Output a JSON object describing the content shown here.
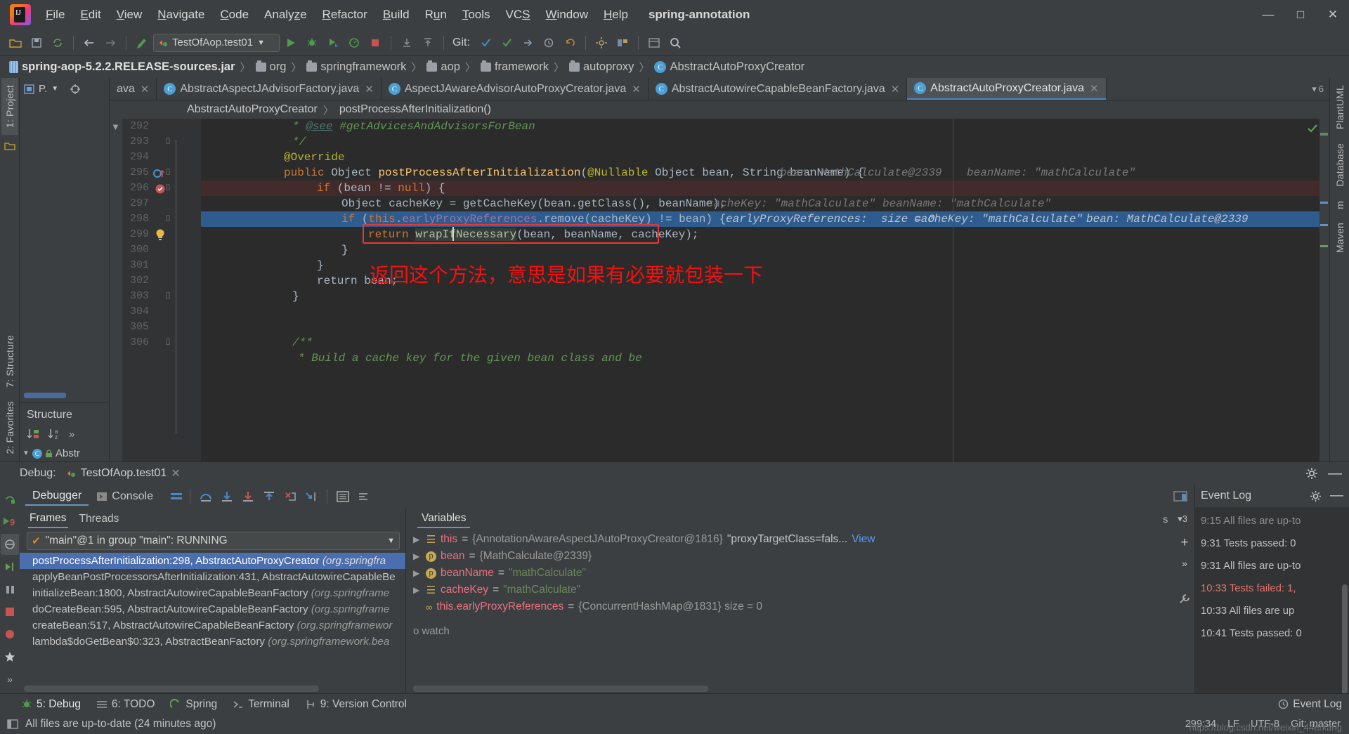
{
  "window": {
    "project_title": "spring-annotation",
    "minimize": "—",
    "maximize": "□",
    "close": "✕"
  },
  "menu": [
    {
      "label": "File",
      "accel": "F"
    },
    {
      "label": "Edit",
      "accel": "E"
    },
    {
      "label": "View",
      "accel": "V"
    },
    {
      "label": "Navigate",
      "accel": "N"
    },
    {
      "label": "Code",
      "accel": "C"
    },
    {
      "label": "Analyze",
      "accel": "z"
    },
    {
      "label": "Refactor",
      "accel": "R"
    },
    {
      "label": "Build",
      "accel": "B"
    },
    {
      "label": "Run",
      "accel": "u"
    },
    {
      "label": "Tools",
      "accel": "T"
    },
    {
      "label": "VCS",
      "accel": "S"
    },
    {
      "label": "Window",
      "accel": "W"
    },
    {
      "label": "Help",
      "accel": "H"
    }
  ],
  "toolbar": {
    "run_config": "TestOfAop.test01",
    "git_label": "Git:",
    "icons": [
      "open-folder-icon",
      "save-icon",
      "sync-icon",
      "back-arrow-icon",
      "forward-arrow-icon",
      "build-icon",
      "run-icon",
      "debug-icon",
      "run-coverage-icon",
      "profile-icon",
      "stop-icon",
      "update-project-icon",
      "commit-icon",
      "git-checkmark-icon",
      "git-push-icon",
      "history-icon",
      "undo-icon",
      "settings-icon",
      "structure-icon",
      "project-structure-icon",
      "search-icon"
    ]
  },
  "navbar": {
    "jar": "spring-aop-5.2.2.RELEASE-sources.jar",
    "crumbs": [
      "org",
      "springframework",
      "aop",
      "framework",
      "autoproxy"
    ],
    "class": "AbstractAutoProxyCreator",
    "separator": "〉"
  },
  "left_strip": {
    "project_tab": "1: Project",
    "structure_tab": "7: Structure",
    "favorites_tab": "2: Favorites"
  },
  "right_strip": {
    "plantuml_tab": "PlantUML",
    "database_tab": "Database",
    "maven_tab": "Maven",
    "m_tab": "m"
  },
  "left_panel": {
    "project_label": "P.",
    "structure_title": "Structure",
    "tree_item": "Abstr"
  },
  "editor_tabs": [
    {
      "label": "ava",
      "active": false,
      "truncated": true
    },
    {
      "label": "AbstractAspectJAdvisorFactory.java",
      "active": false
    },
    {
      "label": "AspectJAwareAdvisorAutoProxyCreator.java",
      "active": false
    },
    {
      "label": "AbstractAutowireCapableBeanFactory.java",
      "active": false
    },
    {
      "label": "AbstractAutoProxyCreator.java",
      "active": true
    }
  ],
  "editor_tabs_right_badge": "6",
  "editor_breadcrumb": {
    "class": "AbstractAutoProxyCreator",
    "method": "postProcessAfterInitialization()",
    "separator": "〉"
  },
  "editor": {
    "first_line_number": 292,
    "lines": [
      {
        "n": 292,
        "indent": 2,
        "segments": [
          {
            "t": "* ",
            "c": "cmt"
          },
          {
            "t": "@see",
            "c": "cmt-link"
          },
          {
            "t": " #getAdvicesAndAdvisorsForBean",
            "c": "cmt"
          }
        ],
        "state": "clipped"
      },
      {
        "n": 293,
        "indent": 2,
        "segments": [
          {
            "t": "*/",
            "c": "cmt"
          }
        ],
        "fold": "end"
      },
      {
        "n": 294,
        "indent": 1,
        "segments": [
          {
            "t": "@Override",
            "c": "ann"
          }
        ]
      },
      {
        "n": 295,
        "indent": 1,
        "segments": [
          {
            "t": "public ",
            "c": "kw"
          },
          {
            "t": "Object ",
            "c": "cls"
          },
          {
            "t": "postProcessAfterInitialization",
            "c": "fn"
          },
          {
            "t": "(",
            "c": "plain"
          },
          {
            "t": "@Nullable ",
            "c": "ann"
          },
          {
            "t": "Object bean, String beanName",
            "c": "cls"
          },
          {
            "t": ") {",
            "c": "plain"
          }
        ],
        "fold": "start",
        "gutter_icon": "override-method-icon",
        "hints": [
          {
            "k": "bean:",
            "v": "MathCalculate@2339"
          },
          {
            "k": "beanName:",
            "v": "\"mathCalculate\""
          }
        ]
      },
      {
        "n": 296,
        "indent": 2,
        "segments": [
          {
            "t": "if ",
            "c": "kw"
          },
          {
            "t": "(bean != ",
            "c": "plain"
          },
          {
            "t": "null",
            "c": "kw"
          },
          {
            "t": ") {",
            "c": "plain"
          }
        ],
        "row": "bp",
        "fold": "start",
        "gutter_icon": "breakpoint-icon"
      },
      {
        "n": 297,
        "indent": 3,
        "segments": [
          {
            "t": "Object cacheKey = ",
            "c": "plain"
          },
          {
            "t": "getCacheKey",
            "c": "plain"
          },
          {
            "t": "(bean.getClass(), beanName);",
            "c": "plain"
          }
        ],
        "hints": [
          {
            "k": "cacheKey:",
            "v": "\"mathCalculate\""
          },
          {
            "k": "beanName:",
            "v": "\"mathCalculate\""
          }
        ]
      },
      {
        "n": 298,
        "indent": 3,
        "segments": [
          {
            "t": "if ",
            "c": "kw"
          },
          {
            "t": "(",
            "c": "plain"
          },
          {
            "t": "this",
            "c": "kw"
          },
          {
            "t": ".",
            "c": "plain"
          },
          {
            "t": "earlyProxyReferences",
            "c": "fld"
          },
          {
            "t": ".remove(cacheKey) != bean) {",
            "c": "plain"
          }
        ],
        "row": "exec",
        "fold": "start",
        "hints": [
          {
            "k": "earlyProxyReferences:",
            "v": "size = 0"
          },
          {
            "k": "cacheKey:",
            "v": "\"mathCalculate\""
          },
          {
            "k": "bean:",
            "v": "MathCalculate@2339"
          }
        ]
      },
      {
        "n": 299,
        "indent": 4,
        "segments": [
          {
            "t": "return ",
            "c": "kw"
          },
          {
            "t": "wrapIfNecessary",
            "c": "sel"
          },
          {
            "t": "(bean, beanName, cacheKey);",
            "c": "plain"
          }
        ],
        "boxed": true,
        "gutter_icon": "intention-bulb-icon"
      },
      {
        "n": 300,
        "indent": 3,
        "segments": [
          {
            "t": "}",
            "c": "plain"
          }
        ]
      },
      {
        "n": 301,
        "indent": 2,
        "segments": [
          {
            "t": "}",
            "c": "plain"
          }
        ]
      },
      {
        "n": 302,
        "indent": 2,
        "segments": [
          {
            "t": "return bean;",
            "c": "plain"
          }
        ]
      },
      {
        "n": 303,
        "indent": 1,
        "segments": [
          {
            "t": "}",
            "c": "plain"
          }
        ],
        "fold": "end"
      },
      {
        "n": 304,
        "indent": 0,
        "segments": []
      },
      {
        "n": 305,
        "indent": 0,
        "segments": []
      },
      {
        "n": 306,
        "indent": 1,
        "segments": [
          {
            "t": "/**",
            "c": "cmt"
          }
        ],
        "fold": "start"
      }
    ],
    "annotation_text": "返回这个方法，意思是如果有必要就包装一下",
    "annotation_color": "#fa0f0f",
    "box_color": "#e53935"
  },
  "debug": {
    "title": "Debug:",
    "session": "TestOfAop.test01",
    "close": "✕",
    "tabs": [
      {
        "label": "Debugger",
        "active": true
      },
      {
        "label": "Console",
        "active": false
      }
    ],
    "stepper_icons": [
      "step-over-icon",
      "step-into-icon",
      "force-step-into-icon",
      "step-out-icon",
      "drop-frame-icon",
      "run-to-cursor-icon",
      "evaluate-expression-icon",
      "layout-icon"
    ],
    "side_icons": [
      "rerun-icon",
      "resume-program-icon",
      "mute-breakpoints-icon",
      "step-debug-icon",
      "pause-icon",
      "stop-icon",
      "view-breakpoints-icon",
      "settings-icon"
    ],
    "resume_badge": "9",
    "subtabs": [
      {
        "label": "Frames",
        "active": true
      },
      {
        "label": "Threads",
        "active": false
      }
    ],
    "thread": "\"main\"@1 in group \"main\": RUNNING",
    "frames": [
      {
        "method": "postProcessAfterInitialization:298, AbstractAutoProxyCreator",
        "pkg": "(org.springfra",
        "selected": true
      },
      {
        "method": "applyBeanPostProcessorsAfterInitialization:431, AbstractAutowireCapableBe",
        "pkg": "",
        "selected": false
      },
      {
        "method": "initializeBean:1800, AbstractAutowireCapableBeanFactory ",
        "pkg": "(org.springframe",
        "selected": false
      },
      {
        "method": "doCreateBean:595, AbstractAutowireCapableBeanFactory ",
        "pkg": "(org.springframe",
        "selected": false
      },
      {
        "method": "createBean:517, AbstractAutowireCapableBeanFactory ",
        "pkg": "(org.springframewor",
        "selected": false
      },
      {
        "method": "lambda$doGetBean$0:323, AbstractBeanFactory ",
        "pkg": "(org.springframework.bea",
        "selected": false
      }
    ],
    "variables_label": "Variables",
    "variables": [
      {
        "name": "this",
        "icon": "stack-icon",
        "value": "{AnnotationAwareAspectJAutoProxyCreator@1816} ",
        "extra": "\"proxyTargetClass=fals...",
        "link": "View",
        "expandable": true
      },
      {
        "name": "bean",
        "icon": "param-icon",
        "value": "{MathCalculate@2339}",
        "expandable": true
      },
      {
        "name": "beanName",
        "icon": "param-icon",
        "value": "\"mathCalculate\"",
        "string": true,
        "expandable": true
      },
      {
        "name": "cacheKey",
        "icon": "stack-icon",
        "value": "\"mathCalculate\"",
        "string": true,
        "expandable": true
      },
      {
        "name": "this.earlyProxyReferences",
        "icon": "watch-icon",
        "value": "{ConcurrentHashMap@1831}  size = 0",
        "expandable": false
      }
    ],
    "vars_toolbar_icons": [
      "add-watch-icon",
      "expand-icon"
    ],
    "watches_hint": "o watch",
    "frames_filter_icons": [
      "up-arrow-icon",
      "down-arrow-icon",
      "filter-icon"
    ],
    "frames_counter": "3",
    "s_label": "s"
  },
  "event_log": {
    "title": "Event Log",
    "settings_icon": "gear-icon",
    "minimize_icon": "minimize-icon",
    "entries": [
      {
        "time": "",
        "text": "9:15 All files are up-to",
        "cut": true
      },
      {
        "time": "9:31",
        "text": "Tests passed: 0"
      },
      {
        "time": "9:31",
        "text": "All files are up-to"
      },
      {
        "time": "10:33",
        "text": "Tests failed: 1,",
        "fail": true
      },
      {
        "time": "10:33",
        "text": "All files are up"
      },
      {
        "time": "10:41",
        "text": "Tests passed: 0"
      }
    ]
  },
  "bottom_bar": {
    "items": [
      {
        "label": "5: Debug",
        "accel": "5",
        "icon": "debug-icon",
        "active": true
      },
      {
        "label": "6: TODO",
        "accel": "6",
        "icon": "todo-icon",
        "active": false
      },
      {
        "label": "Spring",
        "icon": "spring-icon",
        "active": false
      },
      {
        "label": "Terminal",
        "icon": "terminal-icon",
        "active": false
      },
      {
        "label": "9: Version Control",
        "accel": "9",
        "icon": "vcs-icon",
        "active": false
      }
    ],
    "event_log_button": "Event Log"
  },
  "status_bar": {
    "message": "All files are up-to-date (24 minutes ago)",
    "caret": "299:34",
    "line_sep": "LF",
    "encoding": "UTF-8",
    "branch": "Git: master",
    "watermark": "https://blog.csdn.net/weixin_44erkang"
  }
}
